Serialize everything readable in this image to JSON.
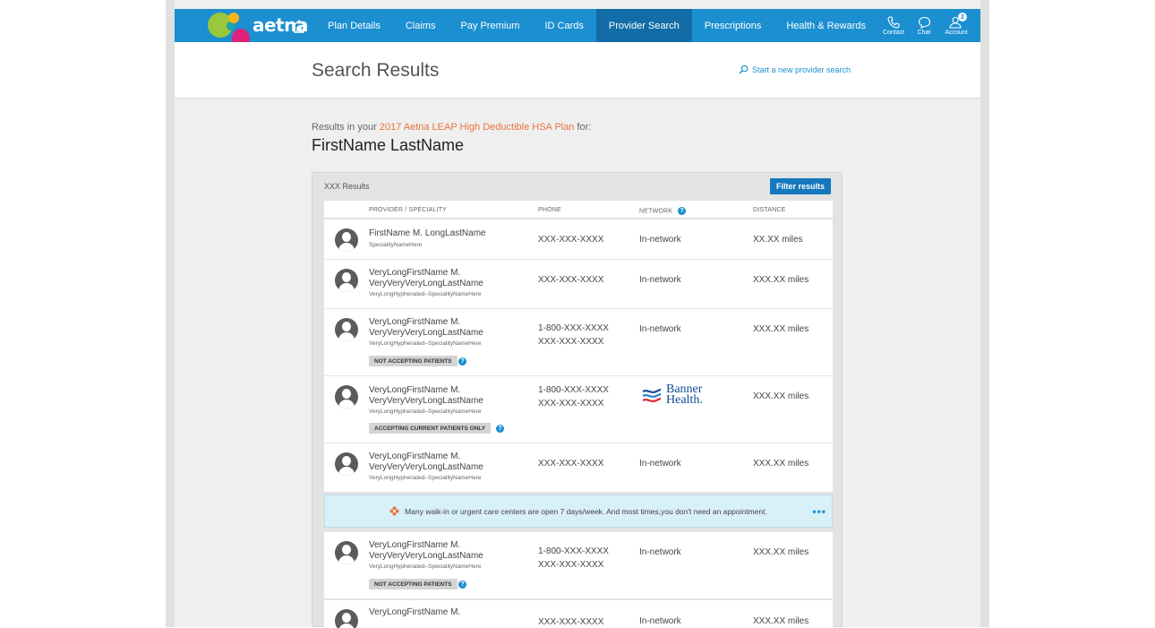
{
  "nav": {
    "logo_text": "aetna",
    "items": [
      "Plan Details",
      "Claims",
      "Pay Premium",
      "ID Cards",
      "Provider Search",
      "Prescriptions",
      "Health & Rewards"
    ],
    "active_item": "Provider Search",
    "utilities": {
      "contact": "Contact",
      "chat": "Chat",
      "account": "Account",
      "account_badge": "2"
    }
  },
  "header": {
    "title": "Search Results",
    "new_search_link": "Start a new provider search"
  },
  "intro": {
    "prefix": "Results in your",
    "plan_name": "2017 Aetna LEAP High Deductible HSA Plan",
    "suffix": "for:",
    "member_name": "FirstName LastName"
  },
  "results": {
    "count_label": "XXX Results",
    "filter_button": "Filter results",
    "columns": {
      "provider": "PROVIDER / SPECIALITY",
      "phone": "PHONE",
      "network": "NETWORK",
      "distance": "DISTANCE"
    },
    "rows": [
      {
        "name1": "FirstName M. LongLastName",
        "name2": "",
        "specialty": "SpecialityNameHere",
        "phone1": "XXX-XXX-XXXX",
        "phone2": "",
        "network": "In-network",
        "distance": "XX.XX miles",
        "tag": ""
      },
      {
        "name1": "VeryLongFirstName M.",
        "name2": "VeryVeryVeryLongLastName",
        "specialty": "VeryLongHyphenated–SpecialityNameHere",
        "phone1": "XXX-XXX-XXXX",
        "phone2": "",
        "network": "In-network",
        "distance": "XXX.XX miles",
        "tag": ""
      },
      {
        "name1": "VeryLongFirstName M.",
        "name2": "VeryVeryVeryLongLastName",
        "specialty": "VeryLongHyphenated–SpecialityNameHere",
        "phone1": "1-800-XXX-XXXX",
        "phone2": "XXX-XXX-XXXX",
        "network": "In-network",
        "distance": "XXX.XX miles",
        "tag": "NOT ACCEPTING PATIENTS"
      },
      {
        "name1": "VeryLongFirstName M.",
        "name2": "VeryVeryVeryLongLastName",
        "specialty": "VeryLongHyphenated–SpecialityNameHere",
        "phone1": "1-800-XXX-XXXX",
        "phone2": "XXX-XXX-XXXX",
        "network": "",
        "network_logo_line1": "Banner",
        "network_logo_line2": "Health.",
        "distance": "XXX.XX miles",
        "tag": "ACCEPTING CURRENT PATIENTS ONLY"
      },
      {
        "name1": "VeryLongFirstName M.",
        "name2": "VeryVeryVeryLongLastName",
        "specialty": "VeryLongHyphenated–SpecialityNameHere",
        "phone1": "XXX-XXX-XXXX",
        "phone2": "",
        "network": "In-network",
        "distance": "XXX.XX miles",
        "tag": ""
      },
      {
        "name1": "VeryLongFirstName M.",
        "name2": "VeryVeryVeryLongLastName",
        "specialty": "VeryLongHyphenated–SpecialityNameHere",
        "phone1": "1-800-XXX-XXXX",
        "phone2": "XXX-XXX-XXXX",
        "network": "In-network",
        "distance": "XXX.XX miles",
        "tag": "NOT ACCEPTING PATIENTS"
      },
      {
        "name1": "VeryLongFirstName M.",
        "name2": "",
        "specialty": "",
        "phone1": "XXX-XXX-XXXX",
        "phone2": "",
        "network": "In-network",
        "distance": "XXX.XX miles",
        "tag": ""
      }
    ],
    "tip_text": "Many walk-in or urgent care centers are open 7 days/week. And most times,you don't need an appointment.",
    "tip_more": "•••"
  },
  "colors": {
    "brand_blue": "#1b8fd0",
    "active_nav": "#126da6",
    "plan_link": "#e8753a",
    "tip_bg": "#d8f0f7"
  }
}
